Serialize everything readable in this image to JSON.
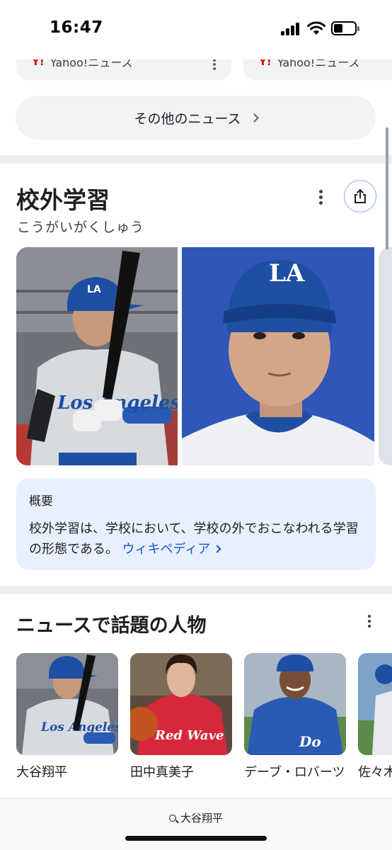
{
  "status_bar": {
    "time": "16:47"
  },
  "news": {
    "cards": [
      {
        "source_logo": "Y!",
        "source": "Yahoo!ニュース"
      },
      {
        "source_logo": "Y!",
        "source": "Yahoo!ニュース"
      }
    ],
    "more_label": "その他のニュース"
  },
  "knowledge_panel": {
    "title": "校外学習",
    "reading": "こうがいがくしゅう",
    "summary_heading": "概要",
    "summary_text": "校外学習は、学校において、学校の外でおこなわれる学習の形態である。",
    "source_link": "ウィキペディア"
  },
  "people": {
    "title": "ニュースで話題の人物",
    "items": [
      {
        "name": "大谷翔平"
      },
      {
        "name": "田中真美子"
      },
      {
        "name": "デーブ・ロバーツ"
      },
      {
        "name": "佐々木"
      }
    ]
  },
  "bottom_search": {
    "query": "大谷翔平"
  },
  "colors": {
    "accent": "#1a57c8",
    "panel_bg": "#e8f0fe",
    "chip_bg": "#f1f3f4",
    "dodgers_blue": "#1e4fa3"
  }
}
